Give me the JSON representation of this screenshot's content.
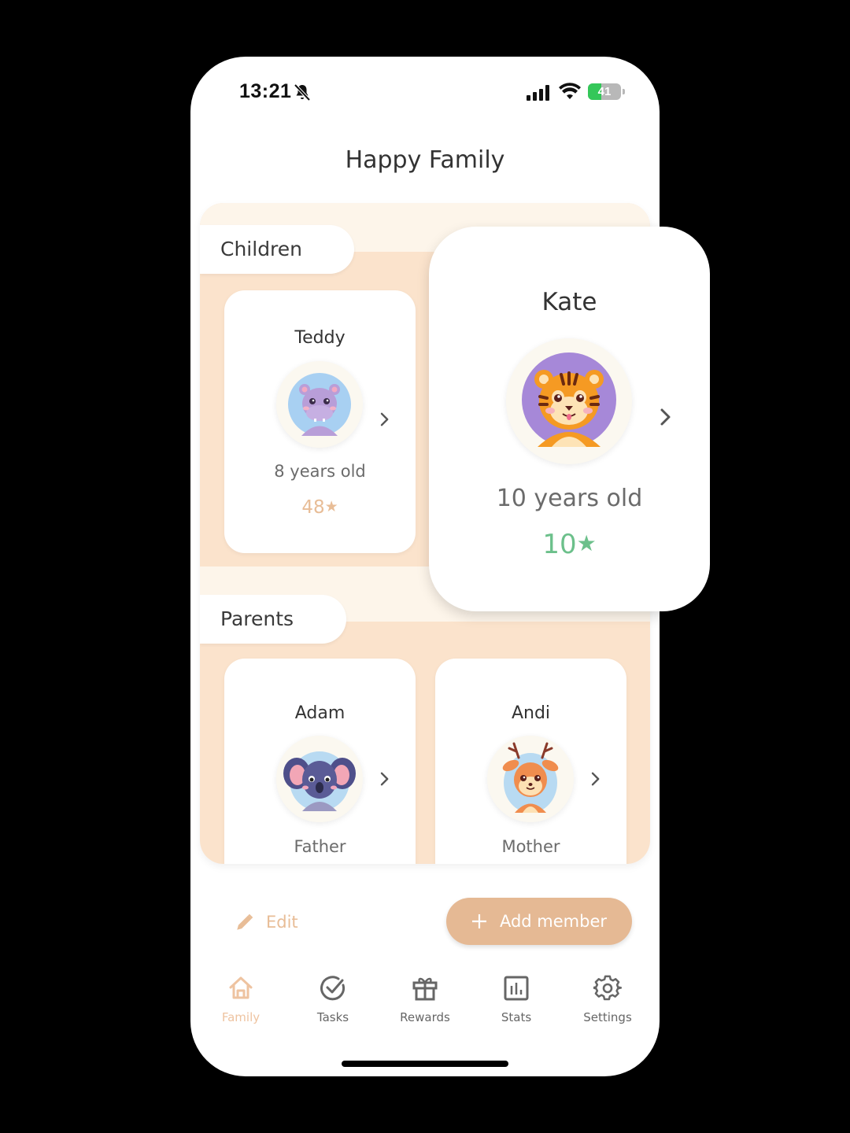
{
  "status_bar": {
    "time": "13:21",
    "silent_icon": "bell-slash-icon",
    "signal_icon": "cellular-signal-icon",
    "wifi_icon": "wifi-icon",
    "battery_percent": 41,
    "battery_label": "41",
    "battery_color": "#34c759"
  },
  "header": {
    "title": "Happy Family"
  },
  "sections": {
    "children_label": "Children",
    "parents_label": "Parents"
  },
  "children": [
    {
      "name": "Teddy",
      "avatar": "hippo-avatar",
      "age": "8 years old",
      "points": "48",
      "points_icon": "star-icon",
      "points_color": "#e8bd97"
    },
    {
      "name": "Kate",
      "avatar": "tiger-avatar",
      "age": "10 years old",
      "points": "10",
      "points_icon": "star-icon",
      "points_color": "#6cc08b"
    }
  ],
  "parents": [
    {
      "name": "Adam",
      "avatar": "koala-avatar",
      "role": "Father"
    },
    {
      "name": "Andi",
      "avatar": "deer-avatar",
      "role": "Mother"
    }
  ],
  "actions": {
    "edit_label": "Edit",
    "add_member_label": "Add member"
  },
  "tabbar": {
    "items": [
      {
        "label": "Family",
        "icon": "home-icon",
        "active": true
      },
      {
        "label": "Tasks",
        "icon": "check-circle-icon",
        "active": false
      },
      {
        "label": "Rewards",
        "icon": "gift-icon",
        "active": false
      },
      {
        "label": "Stats",
        "icon": "bar-chart-icon",
        "active": false
      },
      {
        "label": "Settings",
        "icon": "gear-icon",
        "active": false
      }
    ]
  },
  "colors": {
    "accent": "#e5b994",
    "panel_bg": "#fbe3cc",
    "panel_band": "#fdf5ea"
  }
}
